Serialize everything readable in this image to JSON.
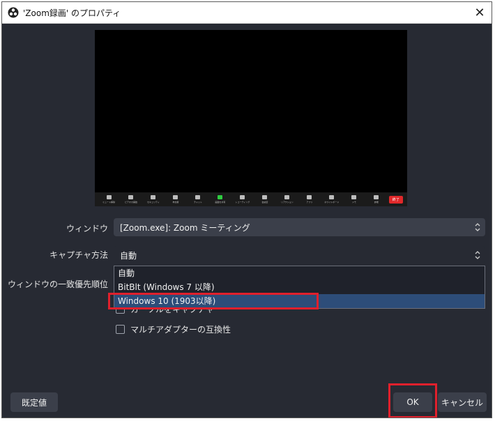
{
  "window": {
    "title": "'Zoom録画' のプロパティ"
  },
  "zoom_toolbar": {
    "buttons": [
      "ミュート解除",
      "ビデオの開始",
      "セキュリティ",
      "参加者",
      "チャット",
      "画面を共有",
      "レコーディング",
      "会議室",
      "リアクション",
      "アプリ",
      "ホワイトボード",
      "メモ",
      "詳細"
    ],
    "end_label": "終了",
    "accent_green": "#2ecc40",
    "end_color": "#e0282a"
  },
  "window_field": {
    "label": "ウィンドウ",
    "value": "[Zoom.exe]: Zoom ミーティング"
  },
  "capture_method": {
    "label": "キャプチャ方法",
    "value": "自動",
    "options": [
      "自動",
      "BitBlt (Windows 7 以降)",
      "Windows 10 (1903以降)"
    ],
    "selected_index": 2
  },
  "window_priority": {
    "label": "ウィンドウの一致優先順位"
  },
  "checkbox_hidden": {
    "label": "カーソルをキャプチャ"
  },
  "checkbox_multi_adapter": {
    "label": "マルチアダプターの互換性"
  },
  "buttons": {
    "defaults": "既定値",
    "ok": "OK",
    "cancel": "キャンセル"
  },
  "colors": {
    "highlight": "#e0202c",
    "selection": "#2d4d79",
    "background": "#272a33"
  }
}
